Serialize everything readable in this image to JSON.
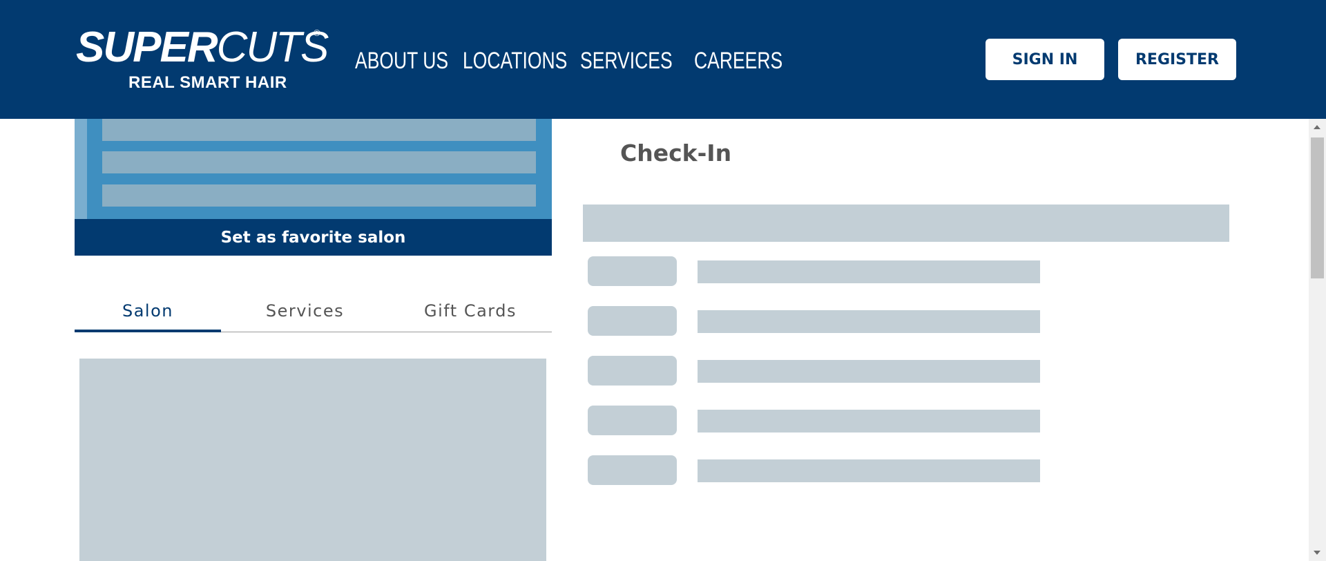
{
  "header": {
    "logo": {
      "super": "SUPER",
      "cuts": "CUTS",
      "registered": "®",
      "tagline": "REAL SMART HAIR"
    },
    "nav": [
      {
        "label": "ABOUT US"
      },
      {
        "label": "LOCATIONS"
      },
      {
        "label": "SERVICES"
      },
      {
        "label": "CAREERS"
      }
    ],
    "sign_in_label": "SIGN IN",
    "register_label": "REGISTER"
  },
  "salon_panel": {
    "favorite_button_label": "Set as favorite salon",
    "tabs": [
      {
        "label": "Salon",
        "active": true
      },
      {
        "label": "Services",
        "active": false
      },
      {
        "label": "Gift Cards",
        "active": false
      }
    ]
  },
  "checkin": {
    "title": "Check-In"
  },
  "colors": {
    "brand_navy": "#023a70",
    "skeleton": "#c3cfd6",
    "card_blue": "#3f8fc0"
  }
}
